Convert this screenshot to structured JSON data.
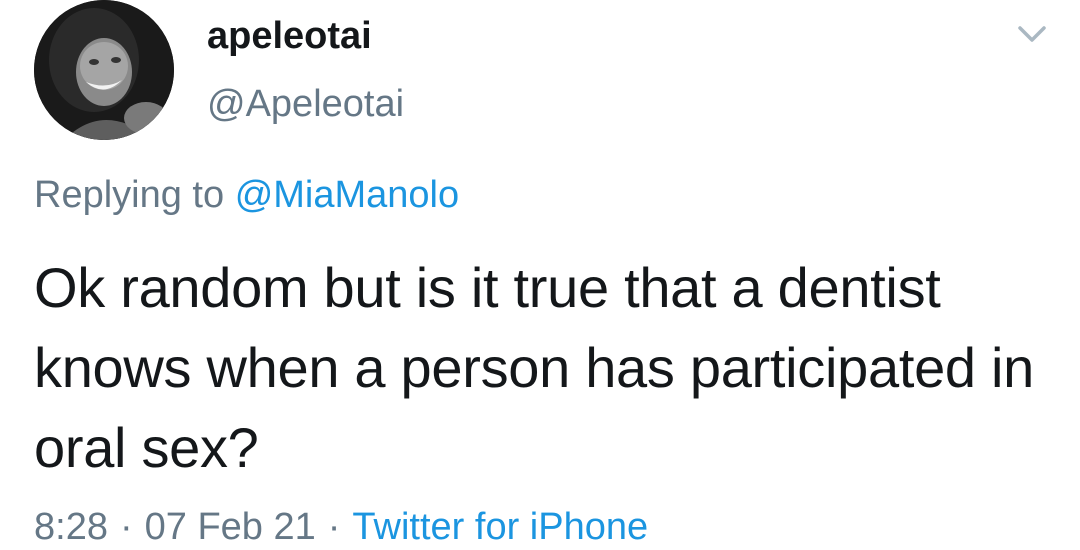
{
  "tweet": {
    "display_name": "apeleotai",
    "handle": "@Apeleotai",
    "avatar_icon": "profile-photo",
    "menu_icon": "chevron-down-icon",
    "reply_prefix": "Replying to",
    "reply_mention": "@MiaManolo",
    "text": "Ok random but is it true that a dentist knows when a person has participated in oral sex?",
    "time": "8:28",
    "date": "07 Feb 21",
    "separator": "·",
    "source": "Twitter for iPhone"
  },
  "colors": {
    "text_primary": "#14171a",
    "text_secondary": "#657786",
    "link": "#1b95e0",
    "chevron": "#aab8c2"
  }
}
